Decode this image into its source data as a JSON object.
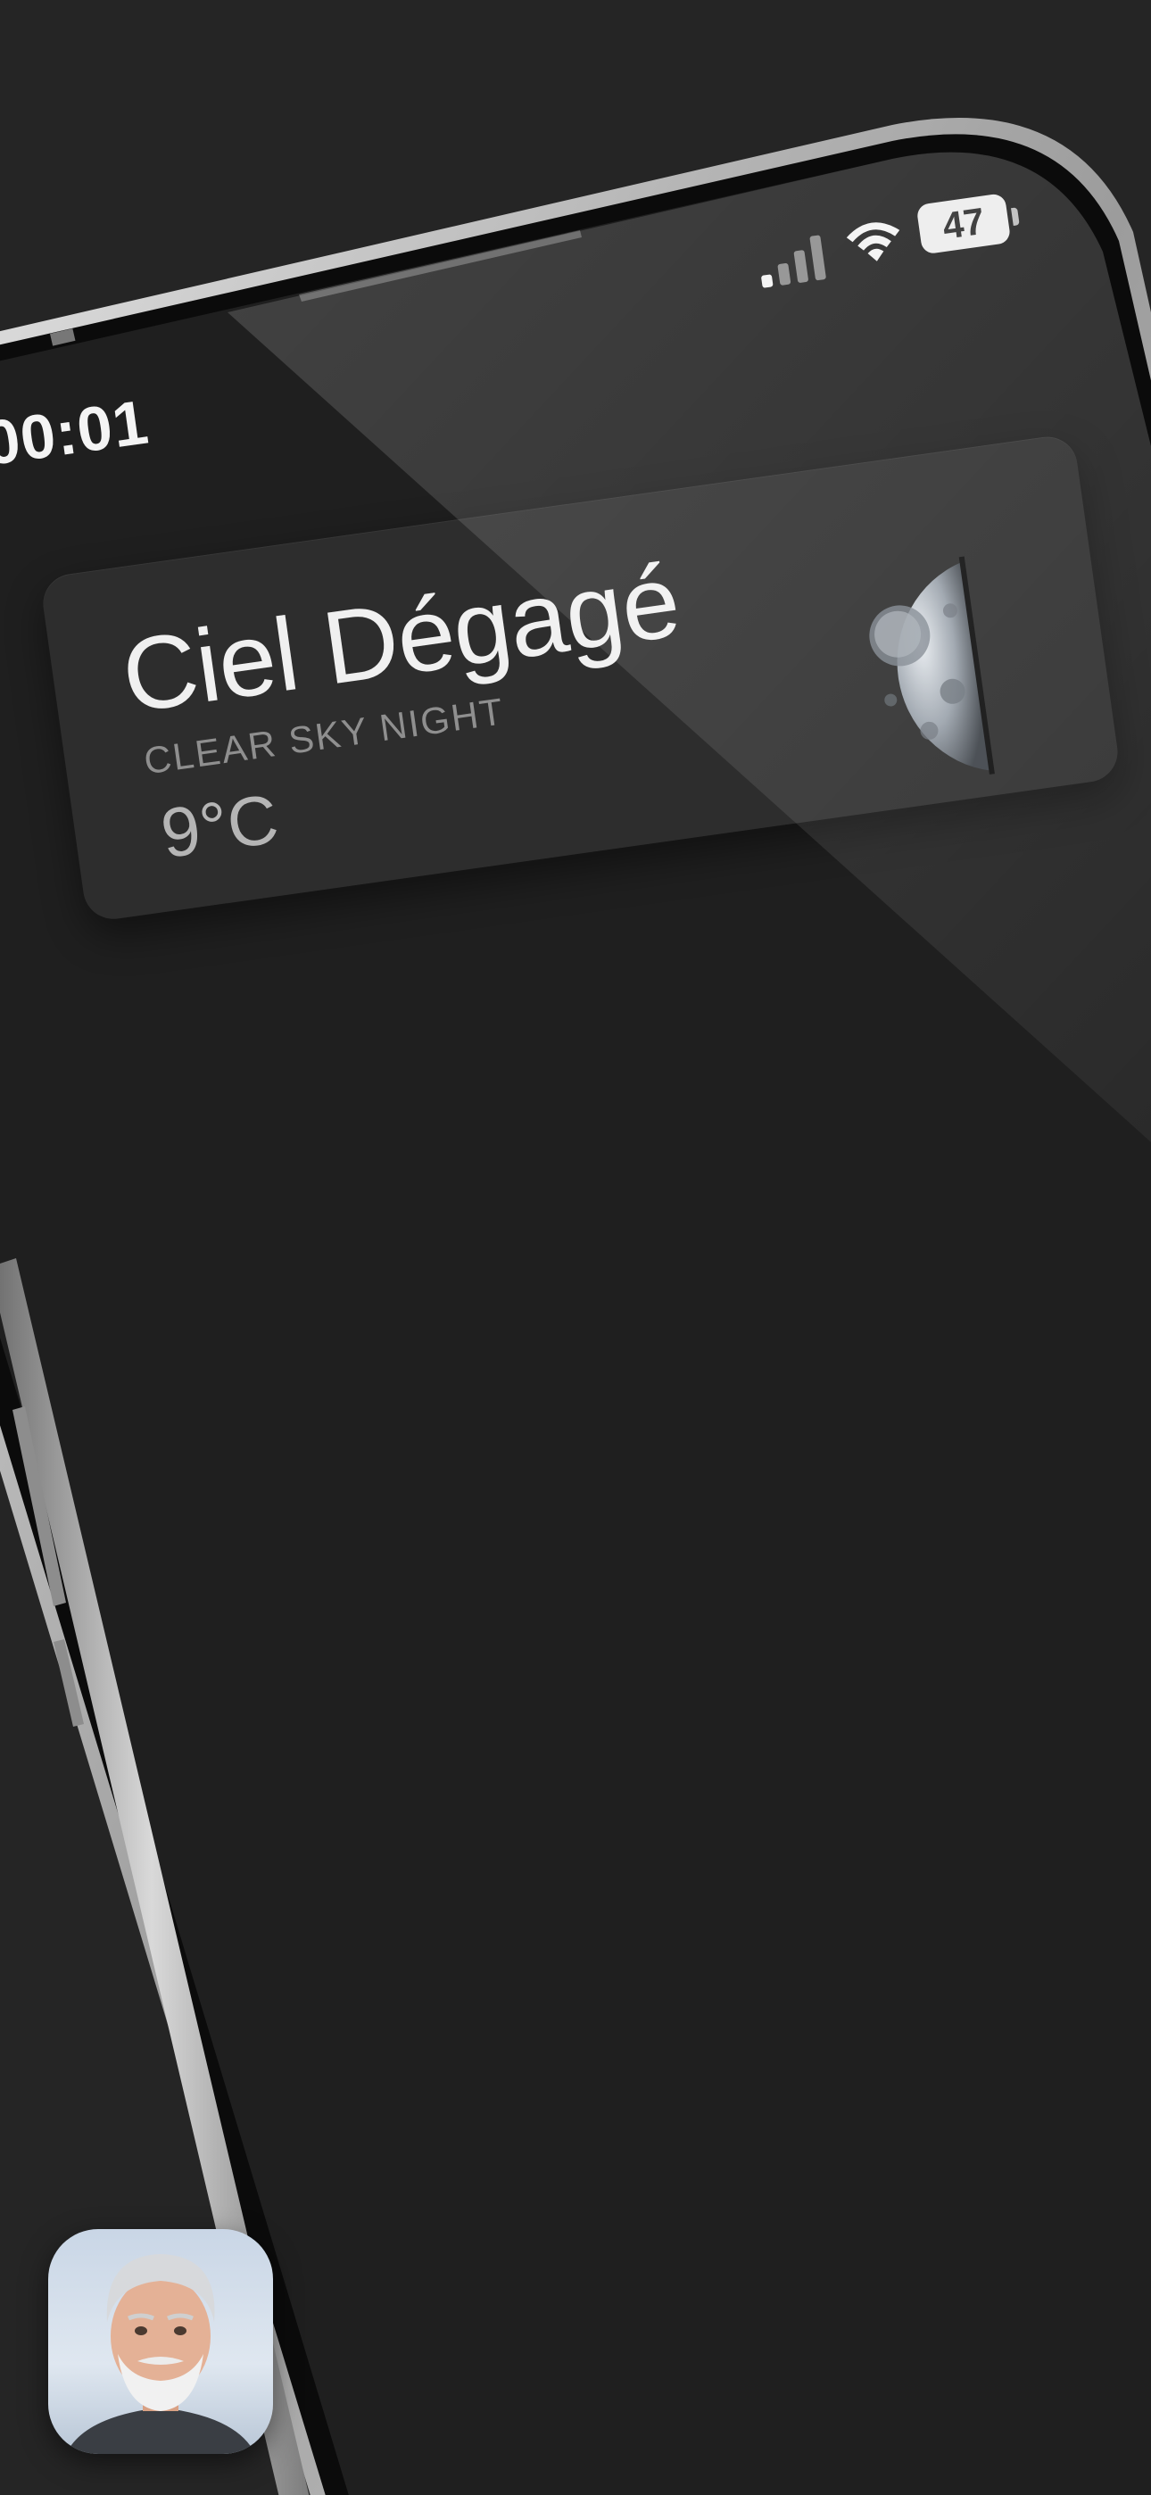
{
  "status_bar": {
    "time": "00:01",
    "battery": "47",
    "signal_icon": "cellular-signal-icon",
    "wifi_icon": "wifi-icon",
    "battery_icon": "battery-icon"
  },
  "widget": {
    "title": "Ciel Dégagé",
    "subtitle": "CLEAR SKY NIGHT",
    "temperature": "9°C",
    "icon": "moon-icon"
  },
  "app_icon": {
    "icon": "avatar-app-icon"
  },
  "colors": {
    "background": "#252525",
    "screen": "#1f1f1f",
    "widget_bg": "#2d2d2d",
    "title_text": "#f0f0f0",
    "subtitle_text": "#8f8f8f",
    "temp_text": "#b5b5b5",
    "frame": "#b8b8b8"
  }
}
